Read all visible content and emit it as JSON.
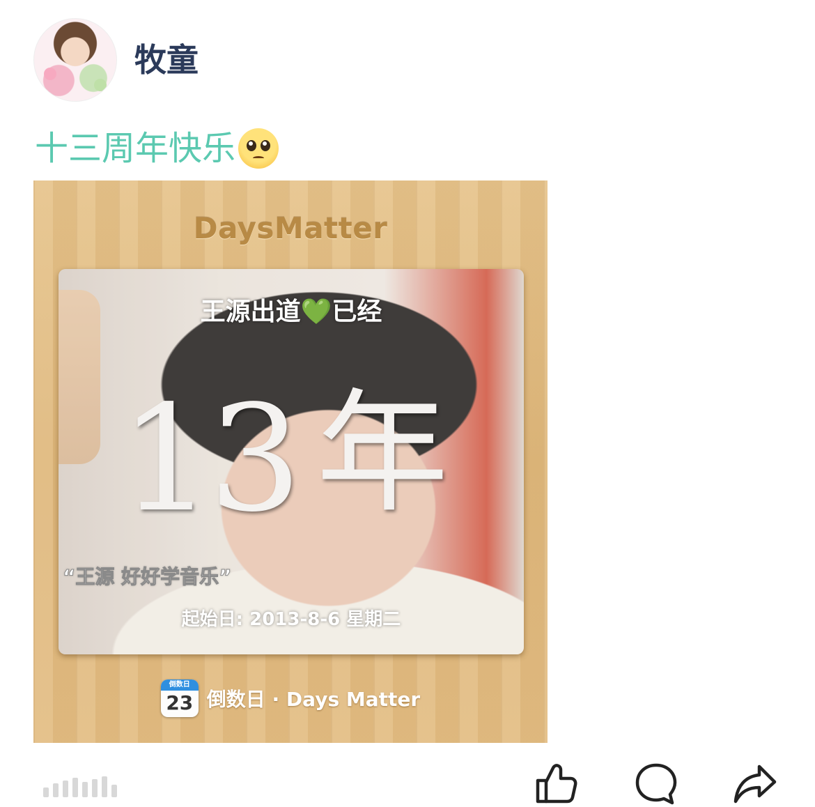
{
  "post": {
    "author": {
      "name": "牧童",
      "avatar": "avatar-image"
    },
    "caption": "十三周年快乐",
    "caption_emoji": "pleading-face-emoji",
    "image": {
      "app_title": "DaysMatter",
      "headline": "王源出道",
      "headline_heart": "💚",
      "headline_suffix": "已经",
      "count_number": "13",
      "count_unit": "年",
      "quote": "“王源 好好学音乐”",
      "start_date": "起始日: 2013-8-6 星期二",
      "calendar_icon_label": "倒数日",
      "calendar_icon_number": "23",
      "app_footer_name": "倒数日 · Days Matter"
    },
    "actions": {
      "like_icon": "thumbs-up-icon",
      "comment_icon": "comment-bubble-icon",
      "share_icon": "share-arrow-icon"
    },
    "colors": {
      "caption": "#5bc9b0",
      "author_name": "#2b3a5a",
      "wood": "#e0bb80",
      "heart": "#4fd14a"
    }
  }
}
